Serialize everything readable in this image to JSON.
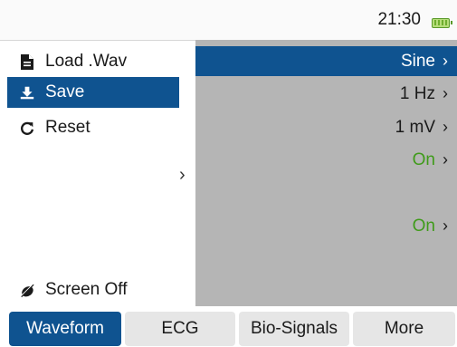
{
  "status": {
    "time": "21:30",
    "battery_icon": "battery-full-icon"
  },
  "left_menu": {
    "items": [
      {
        "label": "Load .Wav",
        "icon": "file-icon",
        "selected": false
      },
      {
        "label": "Save",
        "icon": "download-icon",
        "selected": true
      },
      {
        "label": "Reset",
        "icon": "reset-icon",
        "selected": false
      }
    ],
    "screen_off": {
      "label": "Screen Off",
      "icon": "screen-off-icon"
    },
    "expand_chevron": "›"
  },
  "settings": {
    "rows": [
      {
        "value": "Sine",
        "selected": true
      },
      {
        "value": "1 Hz"
      },
      {
        "value": "1 mV"
      },
      {
        "value": "On",
        "status": true
      },
      {
        "value": "On",
        "status": true
      }
    ],
    "chevron": "›"
  },
  "tabs": [
    {
      "label": "Waveform",
      "active": true
    },
    {
      "label": "ECG",
      "active": false
    },
    {
      "label": "Bio-Signals",
      "active": false
    },
    {
      "label": "More",
      "active": false
    }
  ],
  "colors": {
    "accent": "#0f5390",
    "status_on": "#3f9b1a",
    "panel_gray": "#b5b5b5"
  }
}
